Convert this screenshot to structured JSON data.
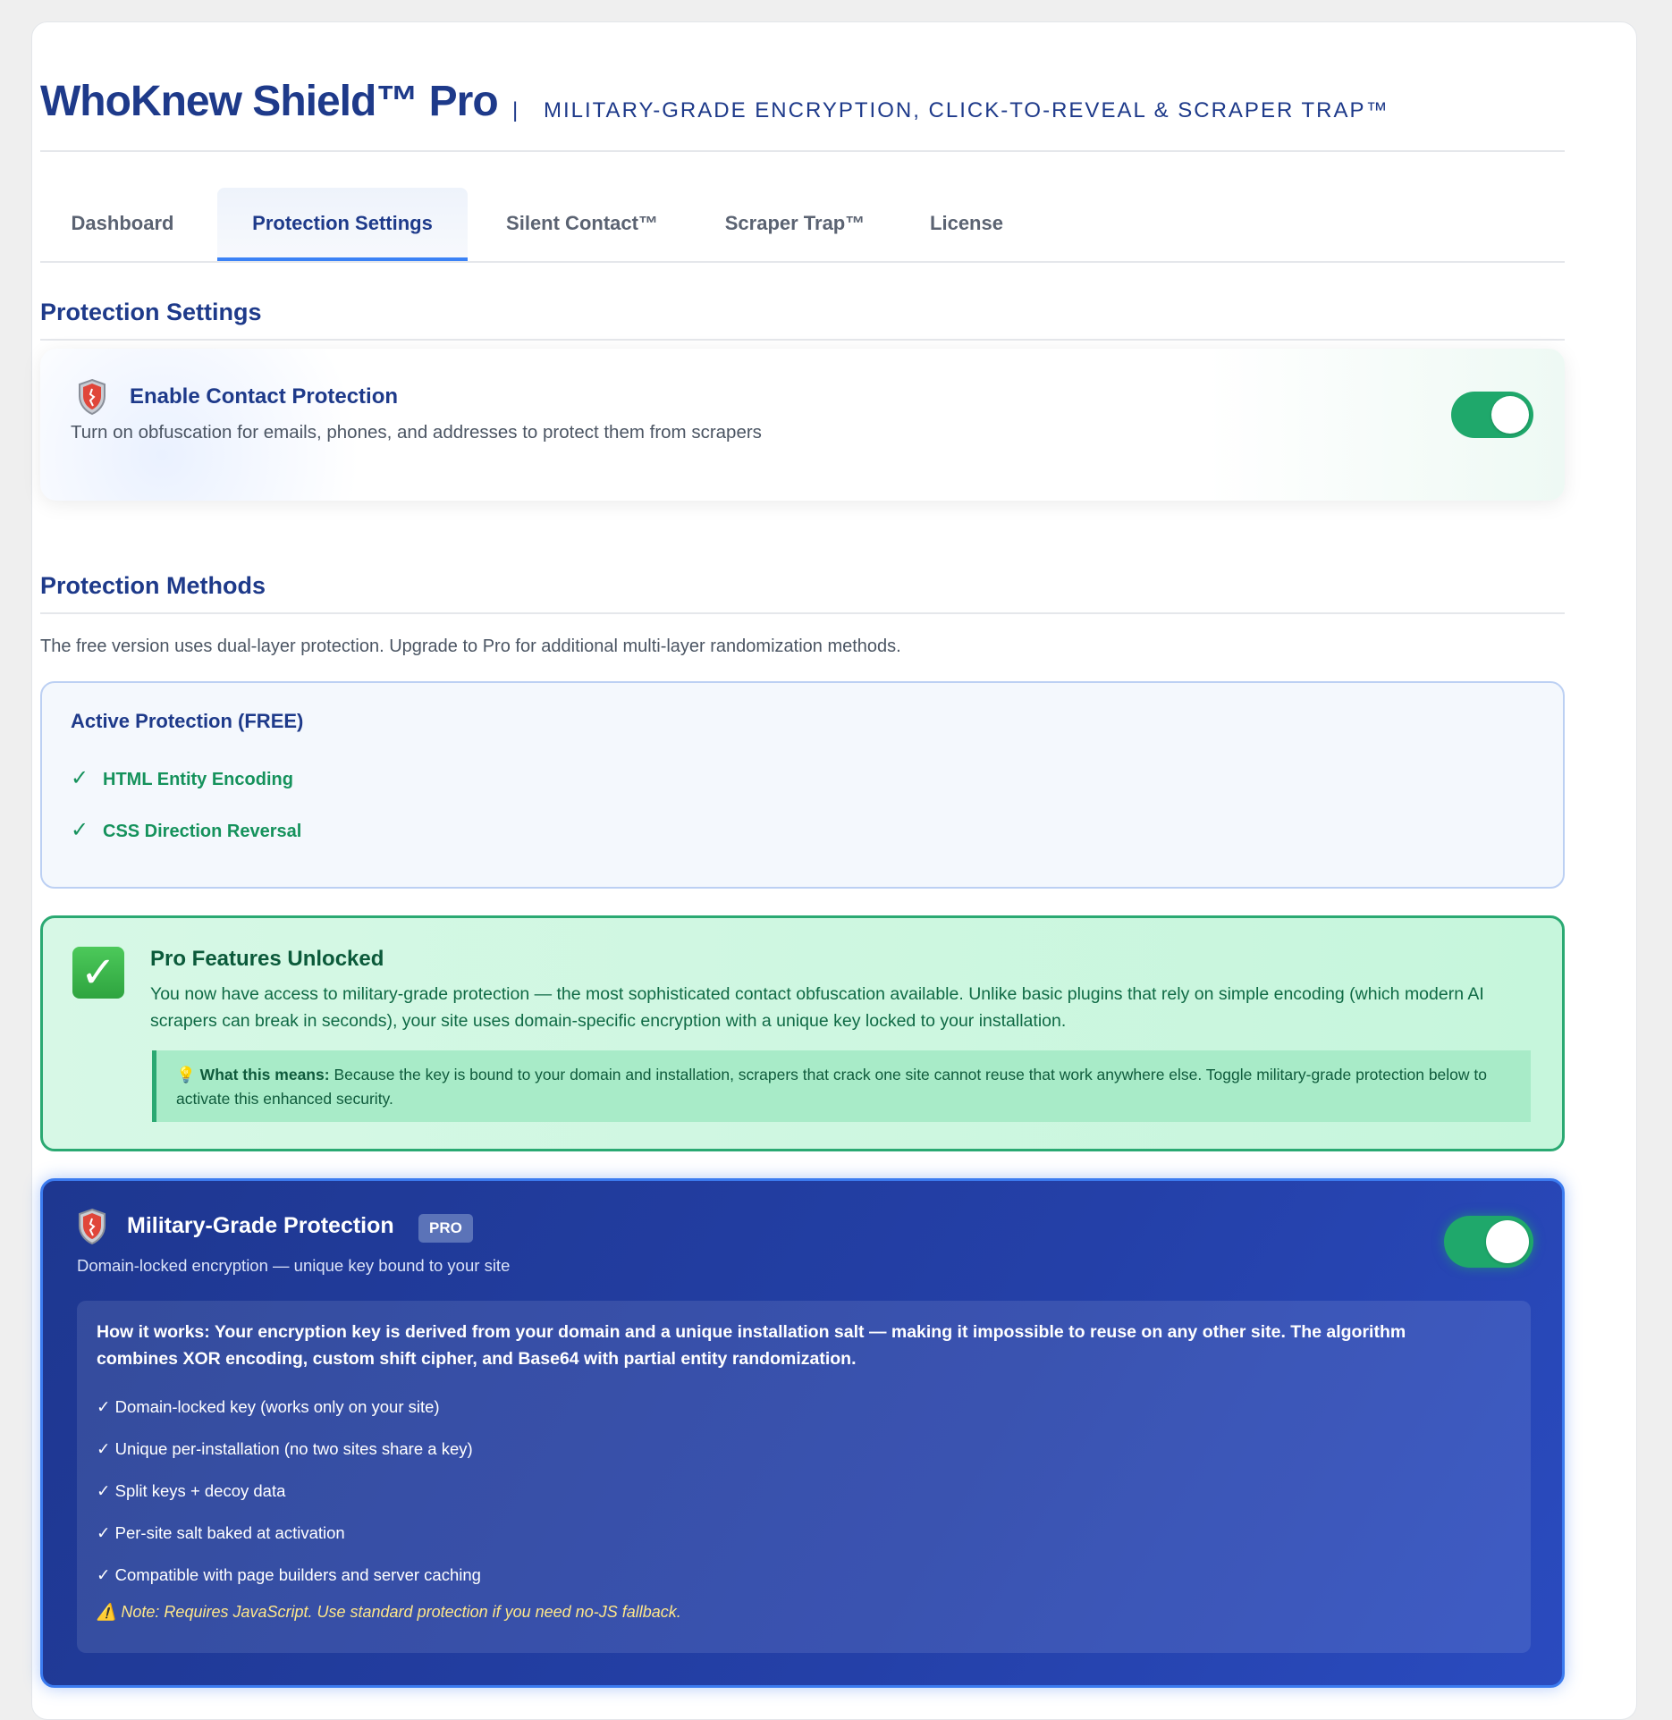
{
  "header": {
    "brand": "WhoKnew Shield™ Pro",
    "separator": "|",
    "tagline": "MILITARY-GRADE ENCRYPTION, CLICK-TO-REVEAL & SCRAPER TRAP™"
  },
  "tabs": [
    {
      "label": "Dashboard",
      "active": false
    },
    {
      "label": "Protection Settings",
      "active": true
    },
    {
      "label": "Silent Contact™",
      "active": false
    },
    {
      "label": "Scraper Trap™",
      "active": false
    },
    {
      "label": "License",
      "active": false
    }
  ],
  "protection_settings": {
    "heading": "Protection Settings",
    "enable": {
      "icon": "shield-icon",
      "title": "Enable Contact Protection",
      "description": "Turn on obfuscation for emails, phones, and addresses to protect them from scrapers",
      "enabled": true
    }
  },
  "methods": {
    "heading": "Protection Methods",
    "description": "The free version uses dual-layer protection. Upgrade to Pro for additional multi-layer randomization methods.",
    "free": {
      "title": "Active Protection (FREE)",
      "items": [
        "HTML Entity Encoding",
        "CSS Direction Reversal"
      ]
    },
    "pro_unlocked": {
      "icon": "check-mark-icon",
      "title": "Pro Features Unlocked",
      "text": "You now have access to military-grade protection — the most sophisticated contact obfuscation available. Unlike basic plugins that rely on simple encoding (which modern AI scrapers can break in seconds), your site uses domain-specific encryption with a unique key locked to your installation.",
      "note_icon": "💡",
      "note_label": "What this means:",
      "note_text": "Because the key is bound to your domain and installation, scrapers that crack one site cannot reuse that work anywhere else. Toggle military-grade protection below to activate this enhanced security."
    },
    "military": {
      "title": "Military-Grade Protection",
      "badge": "PRO",
      "subtitle": "Domain-locked encryption — unique key bound to your site",
      "enabled": true,
      "how": "How it works: Your encryption key is derived from your domain and a unique installation salt — making it impossible to reuse on any other site. The algorithm combines XOR encoding, custom shift cipher, and Base64 with partial entity randomization.",
      "features": [
        "✓ Domain-locked key (works only on your site)",
        "✓ Unique per-installation (no two sites share a key)",
        "✓ Split keys + decoy data",
        "✓ Per-site salt baked at activation",
        "✓ Compatible with page builders and server caching"
      ],
      "warning": "⚠️ Note: Requires JavaScript. Use standard protection if you need no-JS fallback."
    }
  },
  "colors": {
    "brand": "#1e3a8a",
    "toggle_on": "#1fa86b",
    "success": "#15925c",
    "military_bg": "#2440a8"
  }
}
